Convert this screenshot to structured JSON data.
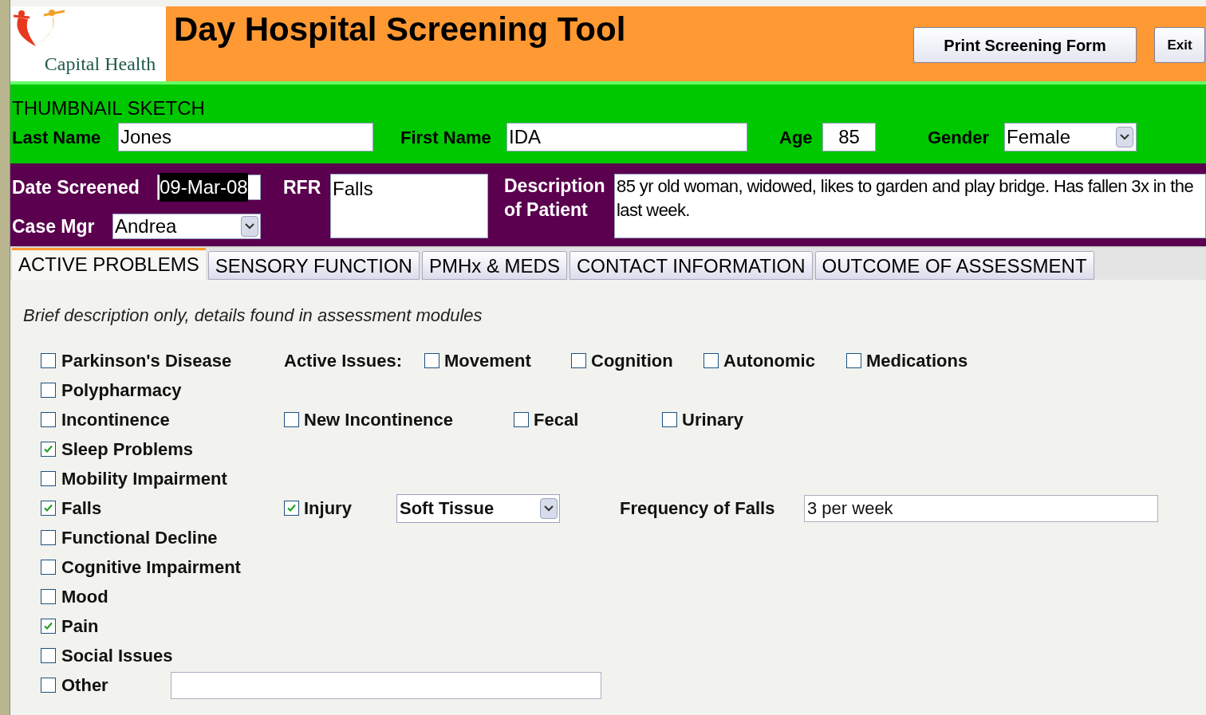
{
  "header": {
    "logo_text": "Capital Health",
    "title": "Day Hospital Screening Tool",
    "buttons": [
      "Print Screening Form",
      "Exit"
    ]
  },
  "sketch": {
    "heading": "THUMBNAIL SKETCH",
    "fields": [
      {
        "kind": "text",
        "label": "Last Name",
        "value": "Jones"
      },
      {
        "kind": "text",
        "label": "First Name",
        "value": "IDA"
      },
      {
        "kind": "text",
        "label": "Age",
        "value": "85"
      },
      {
        "kind": "select",
        "label": "Gender",
        "value": "Female"
      }
    ]
  },
  "screening": {
    "date_label": "Date Screened",
    "date_value": "09-Mar-08",
    "date_selected": true,
    "case_mgr_label": "Case Mgr",
    "case_mgr_value": "Andrea",
    "rfr_label": "RFR",
    "rfr_value": "Falls",
    "description_label": "Description of Patient",
    "description_value": "85 yr old woman, widowed, likes to garden and play bridge.  Has fallen 3x in the last week."
  },
  "tabs": [
    {
      "label": "ACTIVE PROBLEMS",
      "selected": true
    },
    {
      "label": "SENSORY FUNCTION",
      "selected": false
    },
    {
      "label": "PMHx & MEDS",
      "selected": false
    },
    {
      "label": "CONTACT INFORMATION",
      "selected": false
    },
    {
      "label": "OUTCOME OF ASSESSMENT",
      "selected": false
    }
  ],
  "instructions": "Brief description only, details found in assessment modules",
  "problems": [
    {
      "label": "Parkinson's Disease",
      "checked": false,
      "extras": [
        {
          "kind": "label",
          "text": "Active Issues:"
        },
        {
          "kind": "checkbox",
          "text": "Movement",
          "checked": false
        },
        {
          "kind": "checkbox",
          "text": "Cognition",
          "checked": false
        },
        {
          "kind": "checkbox",
          "text": "Autonomic",
          "checked": false
        },
        {
          "kind": "checkbox",
          "text": "Medications",
          "checked": false
        }
      ]
    },
    {
      "label": "Polypharmacy",
      "checked": false
    },
    {
      "label": "Incontinence",
      "checked": false,
      "extras": [
        {
          "kind": "checkbox",
          "text": "New Incontinence",
          "checked": false
        },
        {
          "kind": "checkbox",
          "text": "Fecal",
          "checked": false
        },
        {
          "kind": "checkbox",
          "text": "Urinary",
          "checked": false
        }
      ]
    },
    {
      "label": "Sleep Problems",
      "checked": true
    },
    {
      "label": "Mobility Impairment",
      "checked": false
    },
    {
      "label": "Falls",
      "checked": true,
      "extras": [
        {
          "kind": "checkbox",
          "text": "Injury",
          "checked": true
        },
        {
          "kind": "select",
          "text": "Soft Tissue"
        },
        {
          "kind": "label",
          "text": "Frequency of Falls"
        },
        {
          "kind": "field",
          "text": "3 per week"
        }
      ]
    },
    {
      "label": "Functional Decline",
      "checked": false
    },
    {
      "label": "Cognitive Impairment",
      "checked": false
    },
    {
      "label": "Mood",
      "checked": false
    },
    {
      "label": "Pain",
      "checked": true
    },
    {
      "label": "Social Issues",
      "checked": false
    },
    {
      "label": "Other",
      "checked": false,
      "extras": [
        {
          "kind": "field"
        }
      ]
    }
  ]
}
